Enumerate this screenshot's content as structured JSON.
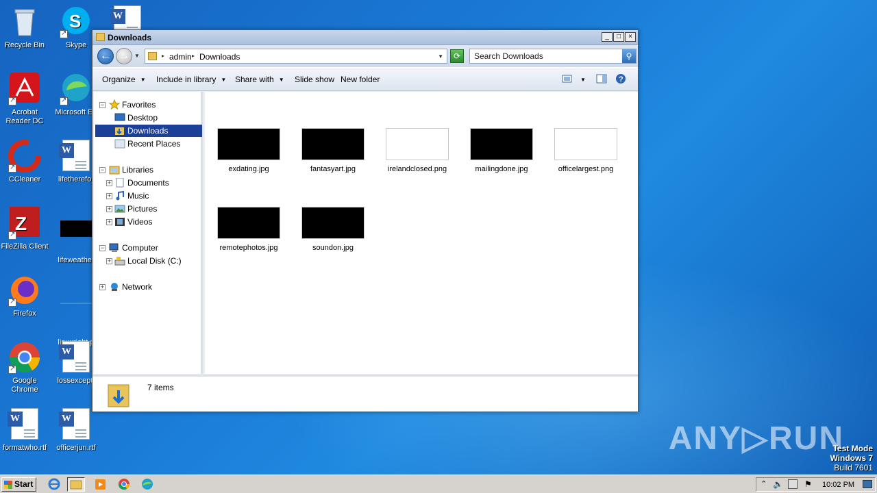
{
  "desktop": {
    "icons": [
      {
        "label": "Recycle Bin"
      },
      {
        "label": "Skype"
      },
      {
        "label": "Acrobat Reader DC"
      },
      {
        "label": "Microsoft Ed"
      },
      {
        "label": "CCleaner"
      },
      {
        "label": "lifetherefor"
      },
      {
        "label": "FileZilla Client"
      },
      {
        "label": "lifeweather"
      },
      {
        "label": "Firefox"
      },
      {
        "label": "linuxright.p"
      },
      {
        "label": "Google Chrome"
      },
      {
        "label": "lossexcept."
      },
      {
        "label": "formatwho.rtf"
      },
      {
        "label": "officerjun.rtf"
      }
    ]
  },
  "window": {
    "title": "Downloads",
    "controls": {
      "minimize": "_",
      "maximize": "□",
      "close": "×"
    },
    "breadcrumb": [
      "admin",
      "Downloads"
    ],
    "search_placeholder": "Search Downloads",
    "toolbar": {
      "organize": "Organize",
      "include_in_library": "Include in library",
      "share_with": "Share with",
      "slide_show": "Slide show",
      "new_folder": "New folder"
    },
    "nav": {
      "favorites": "Favorites",
      "desktop": "Desktop",
      "downloads": "Downloads",
      "recent_places": "Recent Places",
      "libraries": "Libraries",
      "documents": "Documents",
      "music": "Music",
      "pictures": "Pictures",
      "videos": "Videos",
      "computer": "Computer",
      "local_disk": "Local Disk (C:)",
      "network": "Network"
    },
    "files": [
      {
        "name": "exdating.jpg",
        "thumb": "dark"
      },
      {
        "name": "fantasyart.jpg",
        "thumb": "dark"
      },
      {
        "name": "irelandclosed.png",
        "thumb": "light"
      },
      {
        "name": "mailingdone.jpg",
        "thumb": "dark"
      },
      {
        "name": "officelargest.png",
        "thumb": "light"
      },
      {
        "name": "remotephotos.jpg",
        "thumb": "dark"
      },
      {
        "name": "soundon.jpg",
        "thumb": "dark"
      }
    ],
    "status": {
      "count": "7 items"
    }
  },
  "taskbar": {
    "start_label": "Start",
    "clock": "10:02 PM"
  },
  "overlay": {
    "watermark": "ANY▷RUN",
    "test_mode": "Test Mode",
    "os": "Windows 7",
    "build": "Build 7601"
  },
  "colors": {
    "selection": "#1c3f97",
    "desktop": "#1a7ad6"
  }
}
